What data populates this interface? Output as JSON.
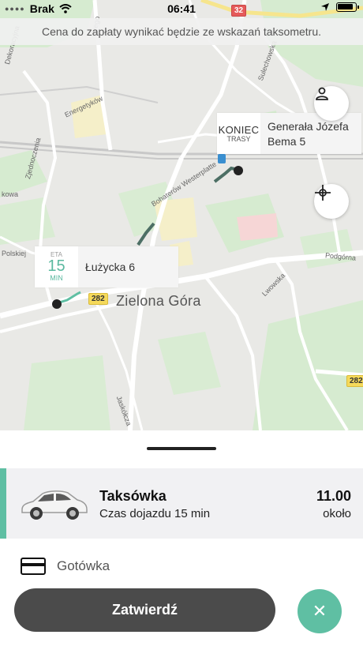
{
  "status_bar": {
    "carrier": "Brak",
    "time": "06:41"
  },
  "notice": "Cena do zapłaty wynikać będzie ze wskazań taksometru.",
  "map": {
    "end_tag_line1": "KONIEC",
    "end_tag_line2": "TRASY",
    "end_address_line1": "Generała Józefa",
    "end_address_line2": "Bema 5",
    "eta_label": "ETA",
    "eta_value": "15",
    "eta_unit": "MIN",
    "start_address": "Łużycka 6",
    "city": "Zielona Góra",
    "road_badges": [
      "32",
      "282",
      "282"
    ],
    "streets": [
      "Dekoracyjna",
      "Energetyków",
      "Zjednoczenia",
      "Sulechowska",
      "Bohaterów Westerplatte",
      "Podgórna",
      "Lwowska",
      "Jaskółcza",
      "Polskiej",
      "kowa",
      "torego"
    ]
  },
  "ride": {
    "name": "Taksówka",
    "eta": "Czas dojazdu 15 min",
    "price": "11.00",
    "approx": "około"
  },
  "payment": {
    "label": "Gotówka"
  },
  "actions": {
    "confirm": "Zatwierdź",
    "cancel": "✕"
  },
  "colors": {
    "accent": "#5fbfa3",
    "confirm_bg": "#4b4b4b"
  }
}
